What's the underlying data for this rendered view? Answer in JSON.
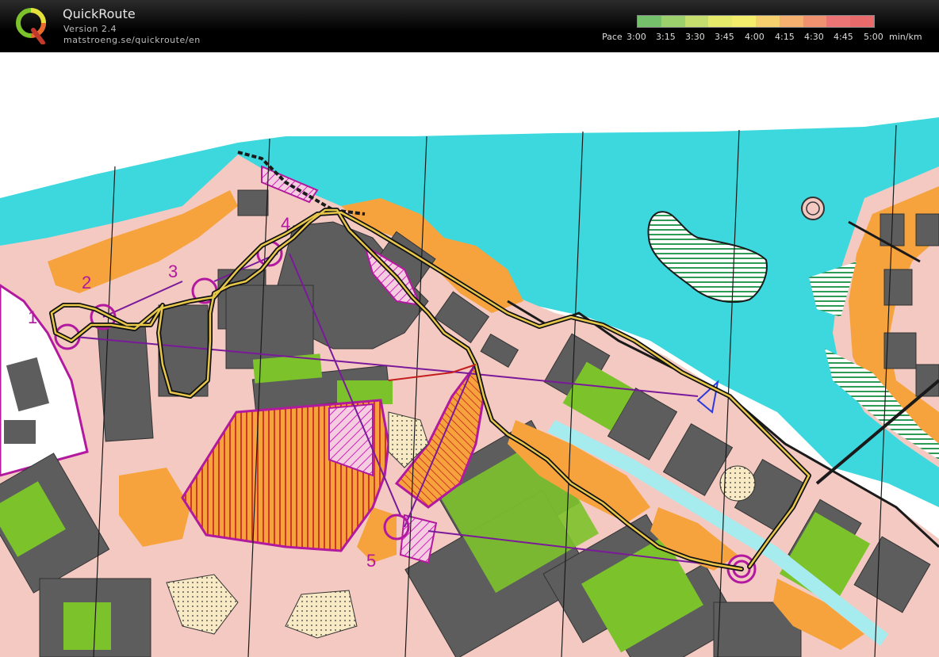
{
  "app": {
    "title": "QuickRoute",
    "version": "Version 2.4",
    "url": "matstroeng.se/quickroute/en"
  },
  "legend": {
    "label": "Pace",
    "ticks": [
      "3:00",
      "3:15",
      "3:30",
      "3:45",
      "4:00",
      "4:15",
      "4:30",
      "4:45",
      "5:00"
    ],
    "unit": "min/km",
    "colors": [
      "#74c06b",
      "#9cd06c",
      "#c4dd6c",
      "#e6ea6a",
      "#f4ec6b",
      "#f6d06c",
      "#f5b06f",
      "#f0926f",
      "#ec7474",
      "#e96a6a"
    ]
  },
  "map": {
    "controls": [
      "1",
      "2",
      "3",
      "4",
      "5"
    ],
    "colors": {
      "water": "#3dd8dd",
      "paved": "#f3c9c2",
      "building": "#5d5d5d",
      "open_land": "#f7a33d",
      "green": "#7cc22b",
      "course": "#b3199f",
      "route": "#1a1a1a"
    }
  }
}
